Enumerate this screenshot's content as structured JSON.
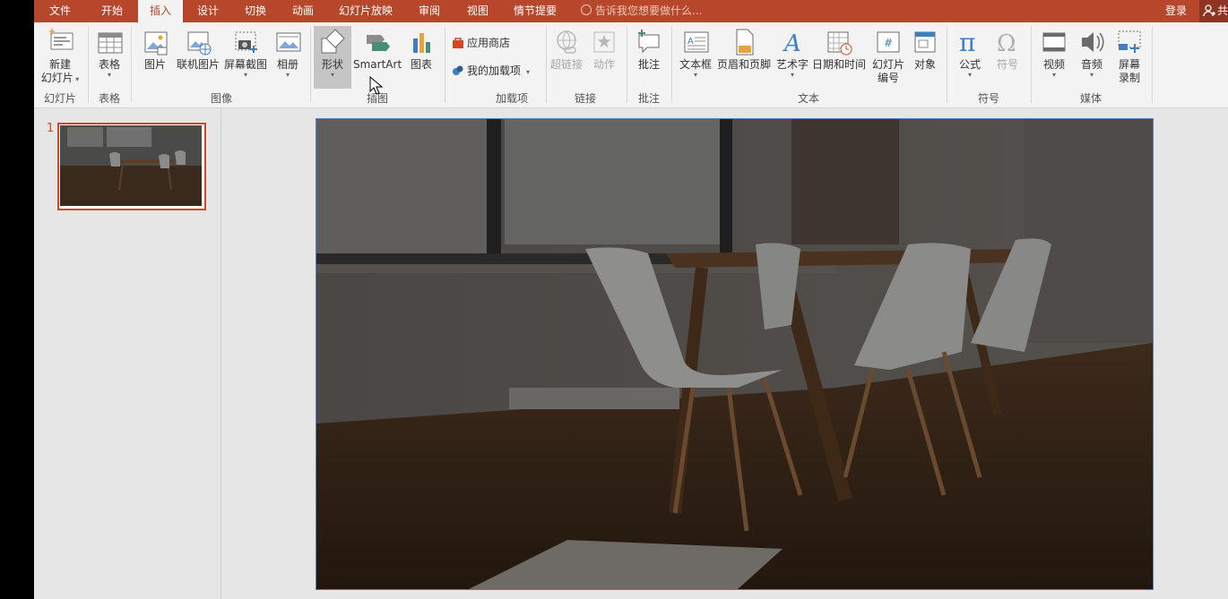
{
  "tabs": [
    {
      "label": "文件",
      "active": false
    },
    {
      "label": "开始",
      "active": false
    },
    {
      "label": "插入",
      "active": true
    },
    {
      "label": "设计",
      "active": false
    },
    {
      "label": "切换",
      "active": false
    },
    {
      "label": "动画",
      "active": false
    },
    {
      "label": "幻灯片放映",
      "active": false
    },
    {
      "label": "审阅",
      "active": false
    },
    {
      "label": "视图",
      "active": false
    },
    {
      "label": "情节提要",
      "active": false
    }
  ],
  "tell_me": "告诉我您想要做什么...",
  "login": "登录",
  "share": "共",
  "ribbon": {
    "new_slide": {
      "line1": "新建",
      "line2": "幻灯片"
    },
    "table": "表格",
    "pictures": "图片",
    "online_pictures": "联机图片",
    "screenshot": "屏幕截图",
    "album": "相册",
    "shapes": "形状",
    "smartart": "SmartArt",
    "chart": "图表",
    "store": "应用商店",
    "my_addins": "我的加载项",
    "hyperlink": "超链接",
    "action": "动作",
    "comment": "批注",
    "textbox": "文本框",
    "header_footer": "页眉和页脚",
    "wordart": "艺术字",
    "datetime": "日期和时间",
    "slide_number": {
      "line1": "幻灯片",
      "line2": "编号"
    },
    "object": "对象",
    "equation": "公式",
    "symbol": "符号",
    "video": "视频",
    "audio": "音频",
    "screen_recording": {
      "line1": "屏幕",
      "line2": "录制"
    },
    "groups": {
      "slides": "幻灯片",
      "tables": "表格",
      "images": "图像",
      "illustrations": "插图",
      "addins": "加载项",
      "links": "链接",
      "comments": "批注",
      "text": "文本",
      "symbols": "符号",
      "media": "媒体"
    }
  },
  "slides": [
    {
      "number": "1"
    }
  ],
  "colors": {
    "accent": "#b7472a",
    "selection": "#d24726",
    "ribbon_bg": "#f3f3f3",
    "slide_border": "#5a7fb3"
  }
}
